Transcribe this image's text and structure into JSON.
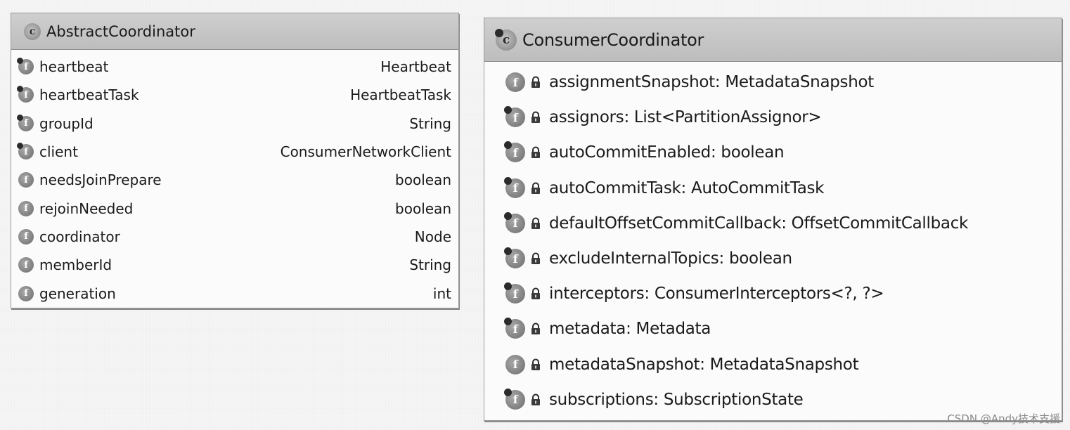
{
  "left_class": {
    "name": "AbstractCoordinator",
    "icon": "class-icon",
    "fields": [
      {
        "name": "heartbeat",
        "type": "Heartbeat",
        "icon": "field-icon",
        "modifier_dot": true
      },
      {
        "name": "heartbeatTask",
        "type": "HeartbeatTask",
        "icon": "field-icon",
        "modifier_dot": true
      },
      {
        "name": "groupId",
        "type": "String",
        "icon": "field-icon",
        "modifier_dot": true
      },
      {
        "name": "client",
        "type": "ConsumerNetworkClient",
        "icon": "field-icon",
        "modifier_dot": true
      },
      {
        "name": "needsJoinPrepare",
        "type": "boolean",
        "icon": "field-icon",
        "modifier_dot": false
      },
      {
        "name": "rejoinNeeded",
        "type": "boolean",
        "icon": "field-icon",
        "modifier_dot": false
      },
      {
        "name": "coordinator",
        "type": "Node",
        "icon": "field-icon",
        "modifier_dot": false
      },
      {
        "name": "memberId",
        "type": "String",
        "icon": "field-icon",
        "modifier_dot": false
      },
      {
        "name": "generation",
        "type": "int",
        "icon": "field-icon",
        "modifier_dot": false
      }
    ]
  },
  "right_class": {
    "name": "ConsumerCoordinator",
    "icon": "class-icon",
    "fields": [
      {
        "label": "assignmentSnapshot: MetadataSnapshot",
        "icon": "field-icon",
        "modifier_dot": false,
        "access": "private"
      },
      {
        "label": "assignors: List<PartitionAssignor>",
        "icon": "field-icon",
        "modifier_dot": true,
        "access": "private"
      },
      {
        "label": "autoCommitEnabled: boolean",
        "icon": "field-icon",
        "modifier_dot": true,
        "access": "private"
      },
      {
        "label": "autoCommitTask: AutoCommitTask",
        "icon": "field-icon",
        "modifier_dot": true,
        "access": "private"
      },
      {
        "label": "defaultOffsetCommitCallback: OffsetCommitCallback",
        "icon": "field-icon",
        "modifier_dot": true,
        "access": "private"
      },
      {
        "label": "excludeInternalTopics: boolean",
        "icon": "field-icon",
        "modifier_dot": true,
        "access": "private"
      },
      {
        "label": "interceptors: ConsumerInterceptors<?, ?>",
        "icon": "field-icon",
        "modifier_dot": true,
        "access": "private"
      },
      {
        "label": "metadata: Metadata",
        "icon": "field-icon",
        "modifier_dot": true,
        "access": "private"
      },
      {
        "label": "metadataSnapshot: MetadataSnapshot",
        "icon": "field-icon",
        "modifier_dot": false,
        "access": "private"
      },
      {
        "label": "subscriptions: SubscriptionState",
        "icon": "field-icon",
        "modifier_dot": true,
        "access": "private"
      }
    ]
  },
  "icons": {
    "class_glyph": "c",
    "field_glyph": "f"
  },
  "watermark": "CSDN @Andy技术支援"
}
